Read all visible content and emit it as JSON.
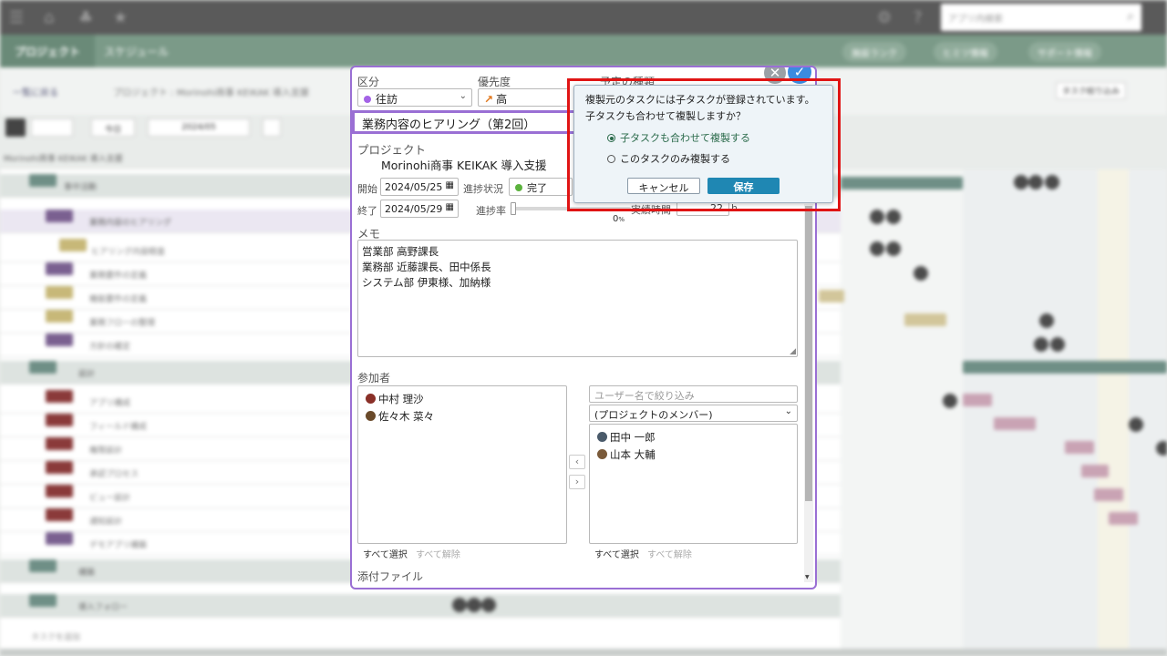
{
  "background": {
    "nav_tabs": [
      "プロジェクト",
      "スケジュール"
    ],
    "search_placeholder": "アプリ内検索",
    "header_buttons": [
      "施設ランク",
      "ヒミツ情報",
      "サポート情報"
    ],
    "back_link": "一覧に戻る",
    "breadcrumb": "プロジェクト : Morinohi商事 KEIKAK 導入支援",
    "filter_button": "タスク絞り込み",
    "today_button": "今日",
    "period_select": "2024/05",
    "project_row_title": "Morinohi商事 KEIKAK 導入支援",
    "tasks": [
      "事中活動",
      "業務内容のヒアリング",
      "ヒアリング内容精査",
      "業務要件の定義",
      "機能要件の定義",
      "業務フローの整理",
      "方針の確定",
      "設計",
      "アプリ構成",
      "フィールド構成",
      "権限設計",
      "承認プロセス",
      "ビュー設計",
      "通知設計",
      "デモアプリ構築",
      "構築",
      "導入フォロー",
      "タスクを追加"
    ]
  },
  "dialog": {
    "category_label": "区分",
    "category_value": "往訪",
    "priority_label": "優先度",
    "priority_value": "高",
    "type_label": "予定の種類",
    "task_title": "業務内容のヒアリング（第2回）",
    "project_label": "プロジェクト",
    "project_value": "Morinohi商事 KEIKAK 導入支援",
    "start_label": "開始",
    "start_date": "2024/05/25",
    "status_label": "進捗状況",
    "status_value": "完了",
    "end_label": "終了",
    "end_date": "2024/05/29",
    "progress_label": "進捗率",
    "progress_value": "0",
    "progress_unit": "%",
    "hours_label": "実績時間",
    "hours_value": "22",
    "hours_unit": "h",
    "memo_label": "メモ",
    "memo_lines": [
      "営業部 高野課長",
      "業務部 近藤課長、田中係長",
      "システム部 伊東様、加納様"
    ],
    "participants_label": "参加者",
    "participants": [
      "中村 理沙",
      "佐々木 菜々"
    ],
    "filter_placeholder": "ユーザー名で絞り込み",
    "member_select": "(プロジェクトのメンバー)",
    "members": [
      "田中 一郎",
      "山本 大輔"
    ],
    "select_all": "すべて選択",
    "clear_all": "すべて解除",
    "attachments_label": "添付ファイル",
    "move_left": "‹",
    "move_right": "›"
  },
  "popup": {
    "message_line1": "複製元のタスクには子タスクが登録されています。",
    "message_line2": "子タスクも合わせて複製しますか？",
    "option_with_children": "子タスクも合わせて複製する",
    "option_only_this": "このタスクのみ複製する",
    "cancel_label": "キャンセル",
    "save_label": "保存"
  },
  "colors": {
    "dialog_border": "#9a6fd4",
    "highlight": "#e01414",
    "save_button": "#1f87b3",
    "confirm_icon": "#3b8be0",
    "close_icon": "#9aa0a6",
    "category_dot": "#a463e6",
    "status_dot": "#5bb23d",
    "priority_arrow": "#e0761b"
  },
  "icons": [
    "menu-icon",
    "home-icon",
    "bell-icon",
    "star-icon",
    "gear-icon",
    "help-icon",
    "search-icon",
    "close-icon",
    "check-icon",
    "calendar-icon",
    "chevron-down-icon",
    "radio-selected-icon",
    "radio-empty-icon"
  ]
}
